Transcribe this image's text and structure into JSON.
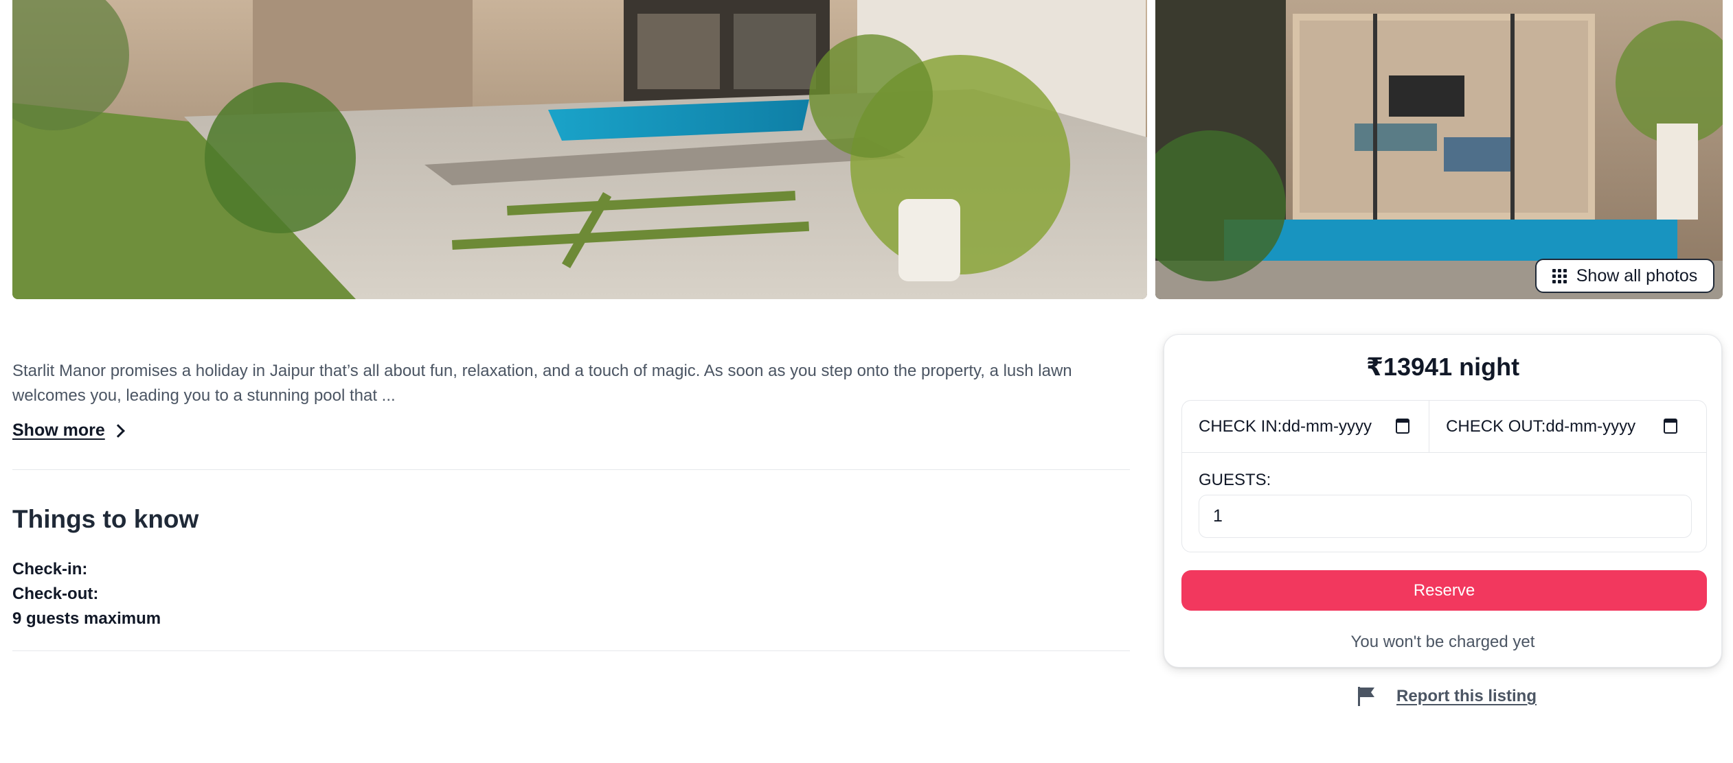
{
  "gallery": {
    "show_all_label": "Show all photos",
    "show_all_icon": "grid-dots-icon"
  },
  "listing": {
    "description": "Starlit Manor promises a holiday in Jaipur that’s all about fun, relaxation, and a touch of magic. As soon as you step onto the property, a lush lawn welcomes you, leading you to a stunning pool that ...",
    "show_more_label": "Show more"
  },
  "things_to_know": {
    "title": "Things to know",
    "check_in": "Check-in:",
    "check_out": "Check-out:",
    "max_guests": "9 guests maximum"
  },
  "booking": {
    "price": "₹13941 night",
    "check_in_label": "CHECK IN:",
    "check_in_value": "dd-mm-yyyy",
    "check_out_label": "CHECK OUT:",
    "check_out_value": "dd-mm-yyyy",
    "guests_label": "GUESTS:",
    "guests_value": "1",
    "reserve_label": "Reserve",
    "note": "You won't be charged yet"
  },
  "report": {
    "label": "Report this listing",
    "icon": "flag-icon"
  },
  "colors": {
    "accent": "#f2385e",
    "text": "#111827",
    "muted": "#4b5563",
    "border": "#e5e7eb"
  }
}
